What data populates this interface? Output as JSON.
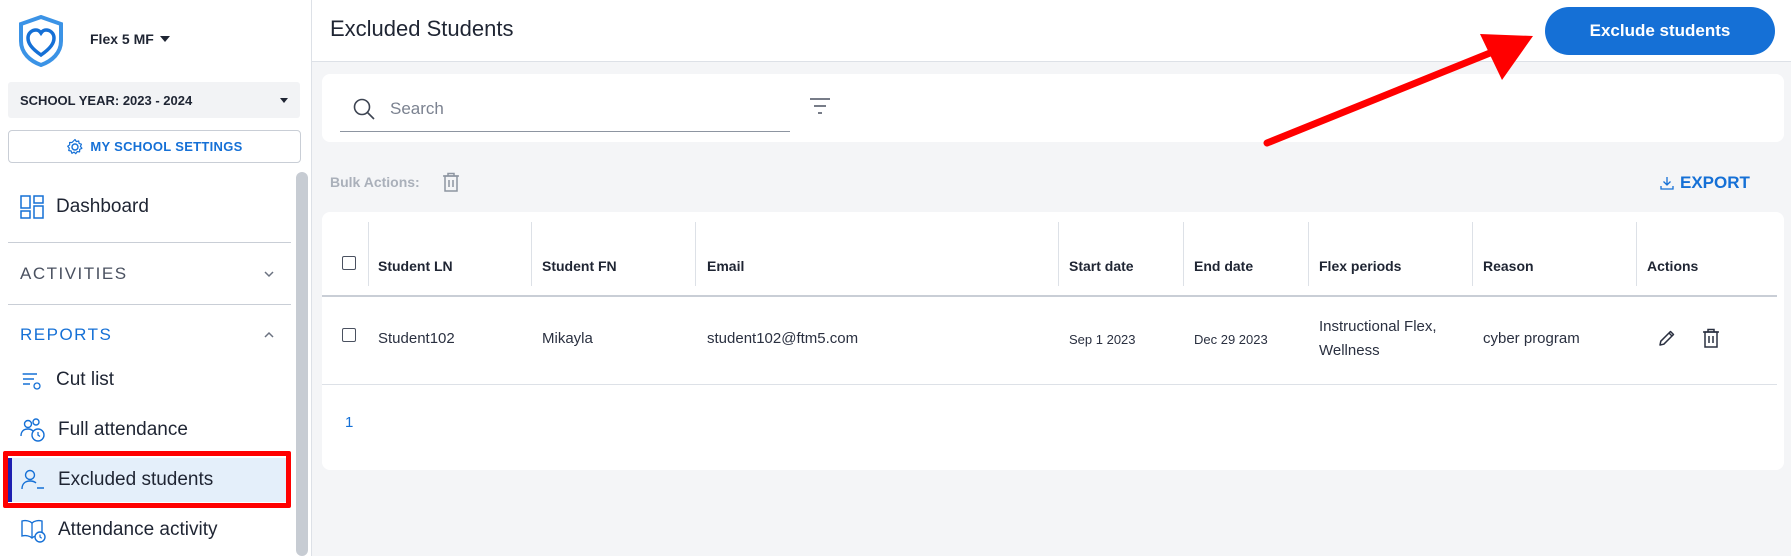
{
  "sidebar": {
    "school_name": "Flex 5 MF",
    "school_year": "SCHOOL YEAR: 2023 - 2024",
    "settings_label": "MY SCHOOL SETTINGS",
    "dashboard": "Dashboard",
    "activities": "ACTIVITIES",
    "reports": "REPORTS",
    "reports_items": [
      {
        "label": "Cut list",
        "icon": "cut-list-icon"
      },
      {
        "label": "Full attendance",
        "icon": "full-attendance-icon"
      },
      {
        "label": "Excluded students",
        "icon": "excluded-students-icon"
      },
      {
        "label": "Attendance activity",
        "icon": "attendance-activity-icon"
      }
    ]
  },
  "header": {
    "title": "Excluded Students",
    "primary_action": "Exclude students"
  },
  "search": {
    "placeholder": "Search"
  },
  "toolbar": {
    "bulk_label": "Bulk Actions:",
    "export_label": "EXPORT"
  },
  "table": {
    "columns": [
      "Student LN",
      "Student FN",
      "Email",
      "Start date",
      "End date",
      "Flex periods",
      "Reason",
      "Actions"
    ],
    "rows": [
      {
        "last_name": "Student102",
        "first_name": "Mikayla",
        "email": "student102@ftm5.com",
        "start_date": "Sep 1 2023",
        "end_date": "Dec 29 2023",
        "flex_periods_line1": "Instructional Flex,",
        "flex_periods_line2": "Wellness",
        "reason": "cyber program"
      }
    ]
  },
  "pagination": {
    "page": "1"
  },
  "colors": {
    "accent": "#1570d6",
    "active_bg": "#e4effa",
    "annotation": "#ff0000"
  }
}
